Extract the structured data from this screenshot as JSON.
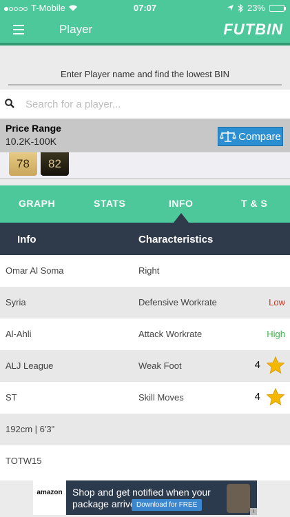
{
  "status": {
    "carrier": "T-Mobile",
    "time": "07:07",
    "battery": "23%",
    "battery_level": 0.23
  },
  "nav": {
    "title": "Player",
    "logo": "FUTBIN"
  },
  "search": {
    "hint": "Enter Player name and find the lowest BIN",
    "placeholder": "Search for a player..."
  },
  "price": {
    "label": "Price Range",
    "value": "10.2K-100K",
    "compare_label": "Compare"
  },
  "ratings": [
    "78",
    "82"
  ],
  "tabs": [
    "GRAPH",
    "STATS",
    "INFO",
    "T & S"
  ],
  "table": {
    "headers": [
      "Info",
      "Characteristics"
    ],
    "rows": [
      {
        "info": "Omar Al Soma",
        "char": "Right",
        "value": ""
      },
      {
        "info": "Syria",
        "char": "Defensive Workrate",
        "value": "Low"
      },
      {
        "info": "Al-Ahli",
        "char": "Attack Workrate",
        "value": "High"
      },
      {
        "info": "ALJ League",
        "char": "Weak Foot",
        "value": "4"
      },
      {
        "info": "ST",
        "char": "Skill Moves",
        "value": "4"
      },
      {
        "info": "192cm | 6'3\"",
        "char": "",
        "value": ""
      },
      {
        "info": "TOTW15",
        "char": "",
        "value": ""
      }
    ]
  },
  "colors": {
    "accent": "#4cc89a",
    "header_dark": "#2f3a4a",
    "low": "#c0392b",
    "high": "#3bb34a",
    "star": "#f5b800",
    "compare": "#2b8fd1"
  },
  "ad": {
    "brand": "amazon",
    "text": "Shop and get notified when your package arrives",
    "button": "Download for FREE"
  }
}
